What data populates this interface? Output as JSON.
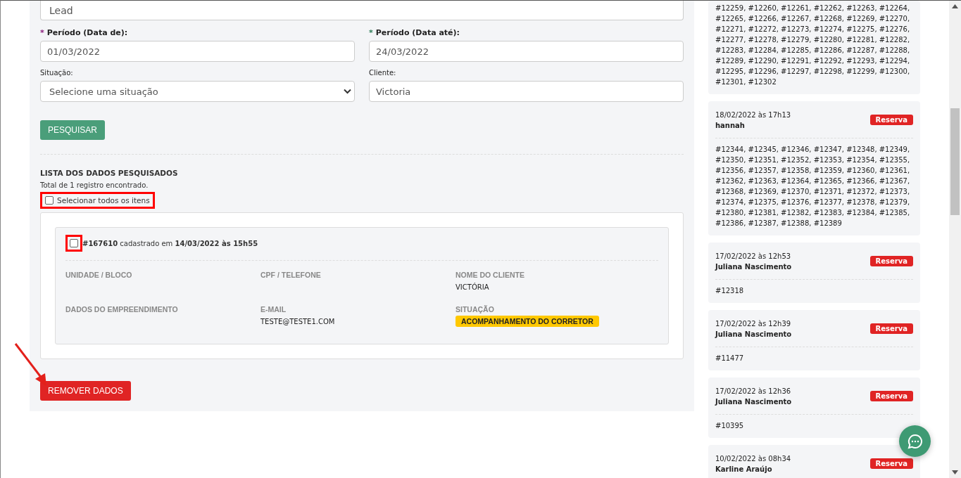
{
  "filters": {
    "type_field": {
      "value": "Lead"
    },
    "date_from": {
      "mark": "*",
      "label": "Período (Data de):",
      "value": "01/03/2022"
    },
    "date_to": {
      "mark": "*",
      "label": "Período (Data até):",
      "value": "24/03/2022"
    },
    "status": {
      "label": "Situação:",
      "placeholder": "Selecione uma situação"
    },
    "client": {
      "label": "Cliente:",
      "value": "Victoria"
    },
    "search_button": "PESQUISAR"
  },
  "results": {
    "title": "LISTA DOS DADOS PESQUISADOS",
    "total": "Total de 1 registro encontrado.",
    "select_all": {
      "label": "Selecionar todos os itens",
      "checked": false,
      "highlighted": true
    },
    "records": [
      {
        "checked": false,
        "highlighted": true,
        "header": "**#167610** cadastrado em **14/03/2022 às 15h55**",
        "fields": [
          {
            "label": "UNIDADE / BLOCO"
          },
          {
            "label": "CPF / TELEFONE"
          },
          {
            "label": "NOME DO CLIENTE",
            "value": "VICTÓRIA"
          },
          {
            "label": "DADOS DO EMPREENDIMENTO"
          },
          {
            "label": "E-MAIL",
            "value": "TESTE@TESTE1.COM"
          },
          {
            "label": "SITUAÇÃO",
            "badge": "ACOMPANHAMENTO DO CORRETOR"
          }
        ]
      }
    ],
    "remove_button": "REMOVER DADOS"
  },
  "history": [
    {
      "units": "#12259, #12260, #12261, #12262, #12263, #12264, #12265, #12266, #12267, #12268, #12269, #12270, #12271, #12272, #12273, #12274, #12275, #12276, #12277, #12278, #12279, #12280, #12281, #12282, #12283, #12284, #12285, #12286, #12287, #12288, #12289, #12290, #12291, #12292, #12293, #12294, #12295, #12296, #12297, #12298, #12299, #12300, #12301, #12302"
    },
    {
      "date": "18/02/2022 às 17h13",
      "name": "hannah",
      "tag": "Reserva",
      "units": "#12344, #12345, #12346, #12347, #12348, #12349, #12350, #12351, #12352, #12353, #12354, #12355, #12356, #12357, #12358, #12359, #12360, #12361, #12362, #12363, #12364, #12365, #12366, #12367, #12368, #12369, #12370, #12371, #12372, #12373, #12374, #12375, #12376, #12377, #12378, #12379, #12380, #12381, #12382, #12383, #12384, #12385, #12386, #12387, #12388, #12389"
    },
    {
      "date": "17/02/2022 às 12h53",
      "name": "Juliana Nascimento",
      "tag": "Reserva",
      "units": "#12318"
    },
    {
      "date": "17/02/2022 às 12h39",
      "name": "Juliana Nascimento",
      "tag": "Reserva",
      "units": "#11477"
    },
    {
      "date": "17/02/2022 às 12h36",
      "name": "Juliana Nascimento",
      "tag": "Reserva",
      "units": "#10395"
    },
    {
      "date": "10/02/2022 às 08h34",
      "name": "Karline Araújo",
      "tag": "Reserva"
    }
  ]
}
